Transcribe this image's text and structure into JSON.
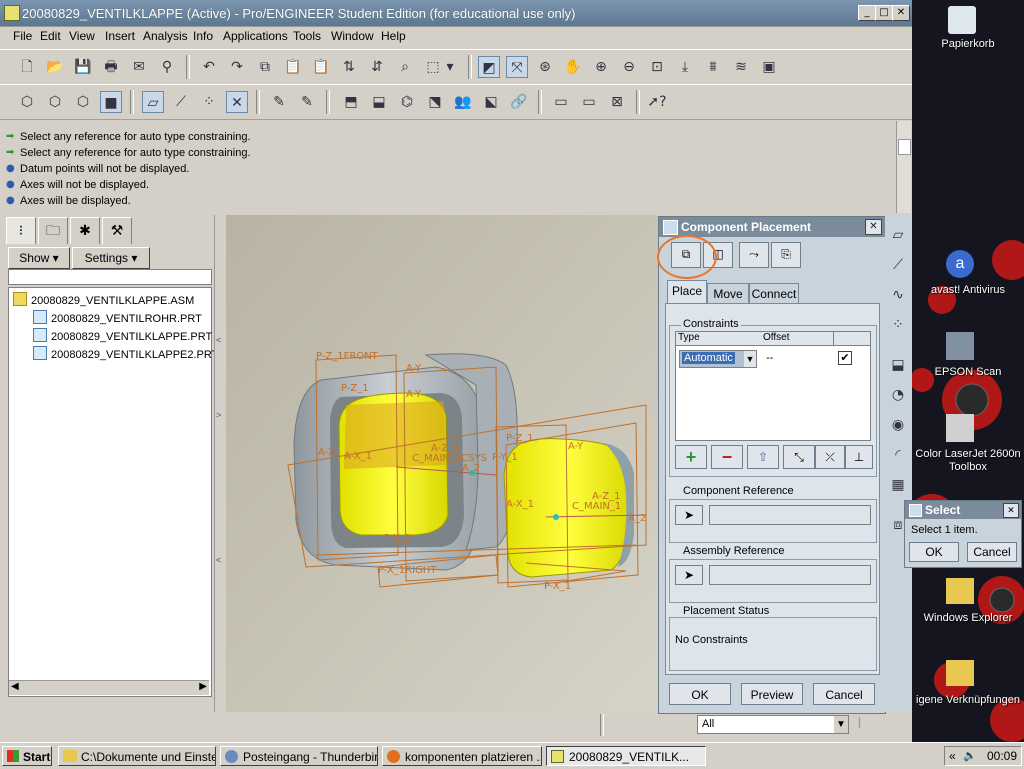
{
  "window": {
    "title": "20080829_VENTILKLAPPE (Active) - Pro/ENGINEER Student Edition (for educational use only)"
  },
  "menu": [
    "File",
    "Edit",
    "View",
    "Insert",
    "Analysis",
    "Info",
    "Applications",
    "Tools",
    "Window",
    "Help"
  ],
  "messages": [
    "Select any reference for auto type constraining.",
    "Select any reference for auto type constraining.",
    "Datum points will not be displayed.",
    "Axes will not be displayed.",
    "Axes will be displayed."
  ],
  "left_panel": {
    "show_label": "Show",
    "settings_label": "Settings",
    "tree": [
      "20080829_VENTILKLAPPE.ASM",
      "20080829_VENTILROHR.PRT",
      "20080829_VENTILKLAPPE.PRT",
      "20080829_VENTILKLAPPE2.PRT"
    ]
  },
  "model_labels": {
    "front": "P-Z_1FRONT",
    "right": "P-X_1RIGHT",
    "pz1": "P-Z_1",
    "ay": "A-Y",
    "ax": "A-X",
    "ax1": "A-X_1",
    "az1": "A-Z_1",
    "csys": "C_MAIN_1CSYS",
    "px1": "P-X_1",
    "a2": "A_2",
    "py": "P-Y_1",
    "cmain": "C_MAIN_1"
  },
  "component_placement": {
    "title": "Component Placement",
    "tabs": [
      "Place",
      "Move",
      "Connect"
    ],
    "constraints_label": "Constraints",
    "col_type": "Type",
    "col_offset": "Offset",
    "type_value": "Automatic",
    "offset_value": "--",
    "component_reference": "Component Reference",
    "assembly_reference": "Assembly Reference",
    "placement_status": "Placement Status",
    "status_value": "No Constraints",
    "ok": "OK",
    "preview": "Preview",
    "cancel": "Cancel"
  },
  "filter": {
    "value": "All"
  },
  "select_dialog": {
    "title": "Select",
    "message": "Select 1 item.",
    "ok": "OK",
    "cancel": "Cancel"
  },
  "desktop": {
    "icons": [
      "Papierkorb",
      "avast! Antivirus",
      "EPSON Scan",
      "Color LaserJet 2600n Toolbox",
      "Windows Explorer",
      "igene Verknüpfungen"
    ]
  },
  "taskbar": {
    "start": "Start",
    "tasks": [
      "C:\\Dokumente und Einste...",
      "Posteingang - Thunderbird",
      "komponenten platzieren ...",
      "20080829_VENTILK..."
    ],
    "clock": "00:09"
  },
  "colors": {
    "accent_orange": "#e8762a",
    "model_yellow": "#f0f000",
    "datum_orange": "#c0702a"
  }
}
